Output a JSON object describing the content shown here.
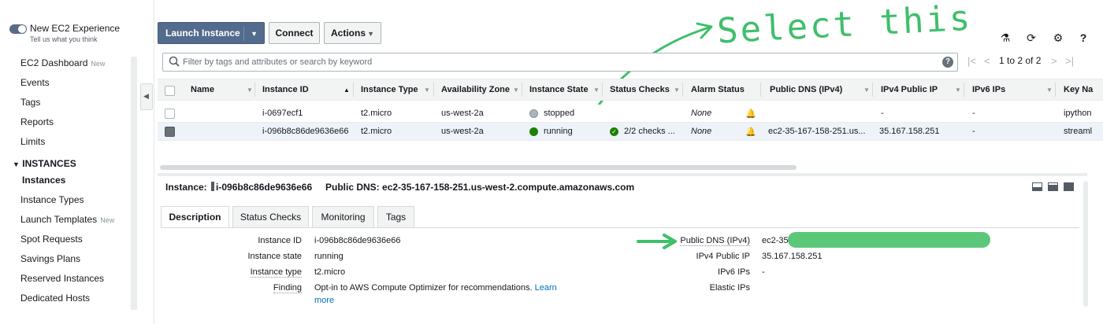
{
  "sidebar": {
    "toggle_label": "New EC2 Experience",
    "toggle_sub": "Tell us what you think",
    "items": [
      {
        "label": "EC2 Dashboard",
        "badge": "New"
      },
      {
        "label": "Events",
        "badge": ""
      },
      {
        "label": "Tags",
        "badge": ""
      },
      {
        "label": "Reports",
        "badge": ""
      },
      {
        "label": "Limits",
        "badge": ""
      }
    ],
    "section": "INSTANCES",
    "instance_items": [
      {
        "label": "Instances",
        "badge": ""
      },
      {
        "label": "Instance Types",
        "badge": ""
      },
      {
        "label": "Launch Templates",
        "badge": "New"
      },
      {
        "label": "Spot Requests",
        "badge": ""
      },
      {
        "label": "Savings Plans",
        "badge": ""
      },
      {
        "label": "Reserved Instances",
        "badge": ""
      },
      {
        "label": "Dedicated Hosts",
        "badge": ""
      }
    ]
  },
  "toolbar": {
    "launch_label": "Launch Instance",
    "connect_label": "Connect",
    "actions_label": "Actions",
    "icons": [
      "flask-icon",
      "refresh-icon",
      "gear-icon",
      "help-icon"
    ]
  },
  "search": {
    "placeholder": "Filter by tags and attributes or search by keyword",
    "pagination": "1 to 2 of 2"
  },
  "table": {
    "columns": [
      "Name",
      "Instance ID",
      "Instance Type",
      "Availability Zone",
      "Instance State",
      "Status Checks",
      "Alarm Status",
      "Public DNS (IPv4)",
      "IPv4 Public IP",
      "IPv6 IPs",
      "Key Na"
    ],
    "rows": [
      {
        "name": "",
        "instance_id": "i-0697ecf1",
        "type": "t2.micro",
        "az": "us-west-2a",
        "state": "stopped",
        "checks": "",
        "alarm": "None",
        "dns": "",
        "ip": "-",
        "ipv6": "-",
        "key": "ipython"
      },
      {
        "name": "",
        "instance_id": "i-096b8c86de9636e66",
        "type": "t2.micro",
        "az": "us-west-2a",
        "state": "running",
        "checks": "2/2 checks ...",
        "alarm": "None",
        "dns": "ec2-35-167-158-251.us...",
        "ip": "35.167.158.251",
        "ipv6": "-",
        "key": "streaml"
      }
    ]
  },
  "detail": {
    "instance_label": "Instance:",
    "instance_id": "i-096b8c86de9636e66",
    "dns_label": "Public DNS:",
    "dns_value": "ec2-35-167-158-251.us-west-2.compute.amazonaws.com",
    "tabs": [
      "Description",
      "Status Checks",
      "Monitoring",
      "Tags"
    ],
    "left_fields": [
      {
        "label": "Instance ID",
        "value": "i-096b8c86de9636e66"
      },
      {
        "label": "Instance state",
        "value": "running"
      },
      {
        "label": "Instance type",
        "value": "t2.micro"
      },
      {
        "label": "Finding",
        "value": "Opt-in to AWS Compute Optimizer for recommendations.",
        "link": "Learn",
        "more": "more"
      }
    ],
    "right_fields": [
      {
        "label": "Public DNS (IPv4)",
        "value": "ec2-35"
      },
      {
        "label": "IPv4 Public IP",
        "value": "35.167.158.251"
      },
      {
        "label": "IPv6 IPs",
        "value": "-"
      },
      {
        "label": "Elastic IPs",
        "value": ""
      }
    ]
  },
  "annotation": {
    "text": "Select this",
    "color": "#3fbf6a"
  }
}
